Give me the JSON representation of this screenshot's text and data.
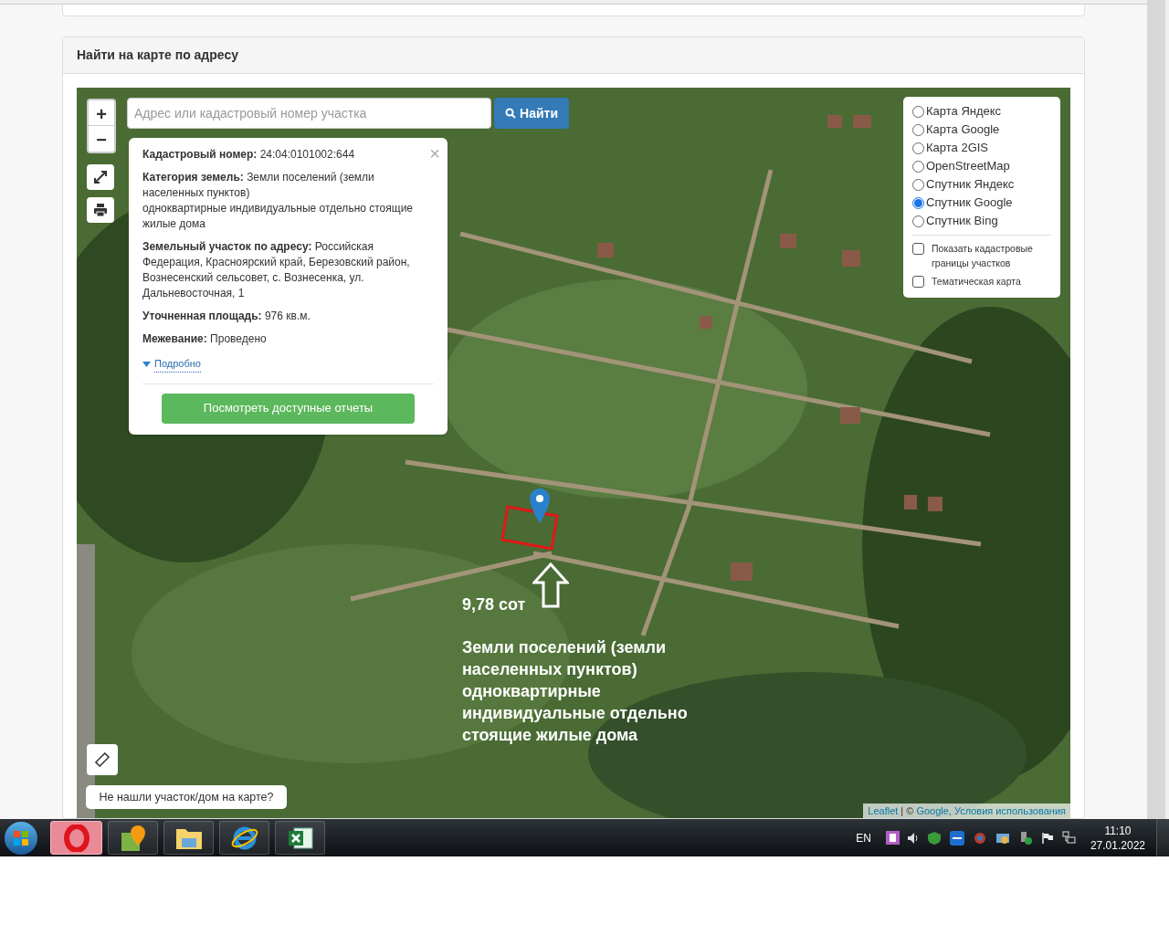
{
  "section_title": "Найти на карте по адресу",
  "map": {
    "zoom_in": "+",
    "zoom_out": "−",
    "search": {
      "placeholder": "Адрес или кадастровый номер участка"
    },
    "search_button": "Найти",
    "popup": {
      "close": "×",
      "fields": [
        {
          "label": "Кадастровый номер:",
          "value": "24:04:0101002:644"
        },
        {
          "label": "Категория земель:",
          "value": "Земли поселений (земли населенных пунктов)\nодноквартирные индивидуальные отдельно стоящие жилые дома"
        },
        {
          "label": "Земельный участок по адресу:",
          "value": "Российская Федерация, Красноярский край, Березовский район, Вознесенский сельсовет, с. Вознесенка, ул. Дальневосточная, 1"
        },
        {
          "label": "Уточненная площадь:",
          "value": "976 кв.м."
        },
        {
          "label": "Межевание:",
          "value": "Проведено"
        }
      ],
      "details_link": "Подробно",
      "reports_button": "Посмотреть доступные отчеты"
    },
    "layers": [
      {
        "label": "Карта Яндекс",
        "selected": false
      },
      {
        "label": "Карта Google",
        "selected": false
      },
      {
        "label": "Карта 2GIS",
        "selected": false
      },
      {
        "label": "OpenStreetMap",
        "selected": false
      },
      {
        "label": "Спутник Яндекс",
        "selected": false
      },
      {
        "label": "Спутник Google",
        "selected": true
      },
      {
        "label": "Спутник Bing",
        "selected": false
      }
    ],
    "overlays": [
      {
        "label": "Показать кадастровые границы участков",
        "checked": false
      },
      {
        "label": "Тематическая карта",
        "checked": false
      }
    ],
    "not_found_button": "Не нашли участок/дом на карте?",
    "attribution": {
      "leaflet": "Leaflet",
      "separator": "| ©",
      "google": "Google,",
      "terms": "Условия использования"
    },
    "annotation": {
      "area": "9,78 сот",
      "description": "Земли поселений (земли населенных пунктов) одноквартирные индивидуальные отдельно стоящие жилые дома"
    }
  },
  "taskbar": {
    "apps": [
      {
        "kind": "opera",
        "selected": true
      },
      {
        "kind": "maps",
        "selected": false
      },
      {
        "kind": "folder",
        "selected": false
      },
      {
        "kind": "browser",
        "selected": false
      },
      {
        "kind": "spreadsheet",
        "selected": false
      }
    ],
    "language": "EN",
    "time": "11:10",
    "date": "27.01.2022"
  }
}
